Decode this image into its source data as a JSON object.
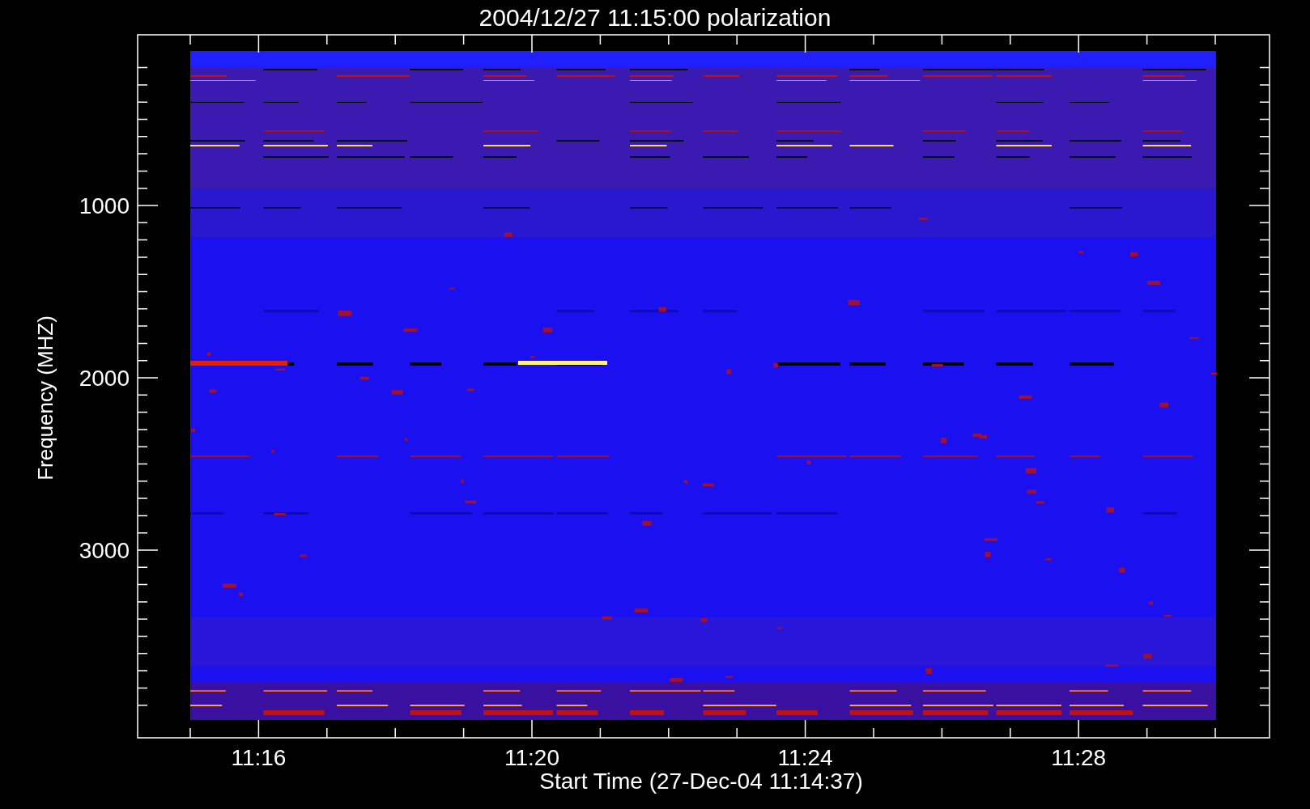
{
  "title": "2004/12/27 11:15:00 polarization",
  "y_axis": {
    "label": "Frequency (MHZ)",
    "tick_labels": [
      "1000",
      "2000",
      "3000"
    ]
  },
  "x_axis": {
    "label": "Start Time (27-Dec-04 11:14:37)",
    "tick_labels": [
      "11:16",
      "11:20",
      "11:24",
      "11:28"
    ]
  }
}
